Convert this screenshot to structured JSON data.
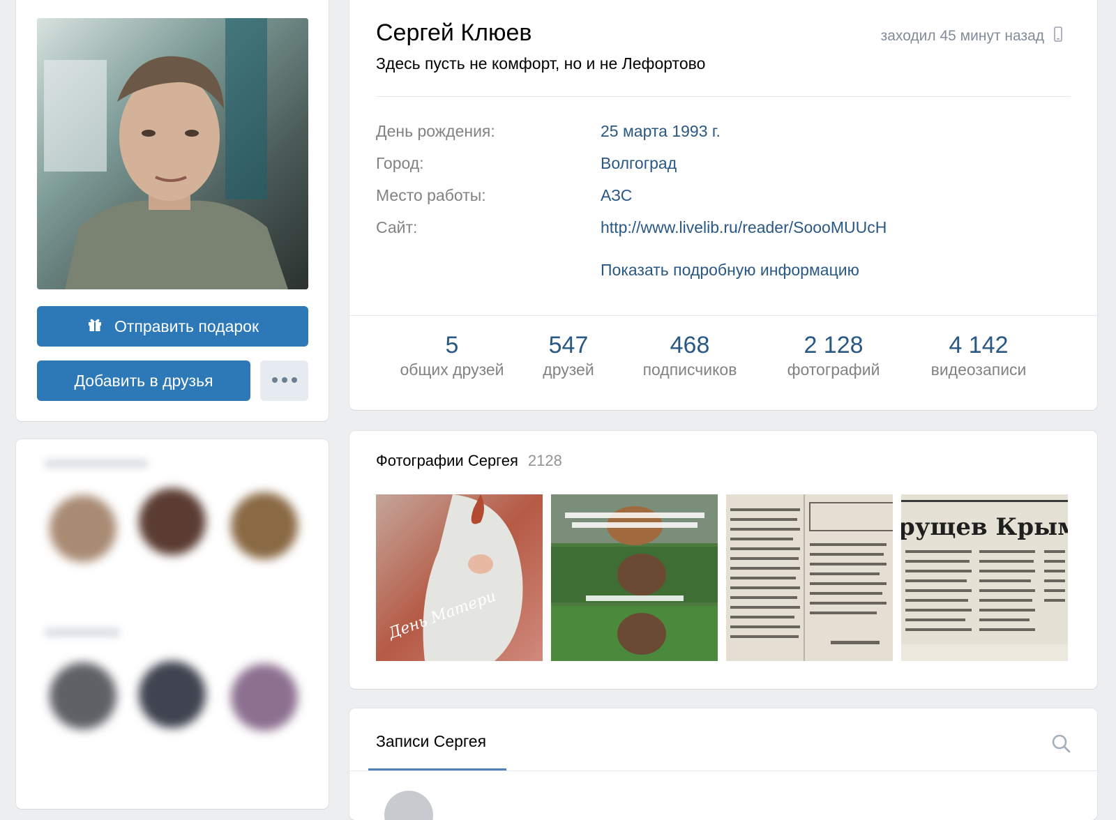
{
  "profile": {
    "name": "Сергей Клюев",
    "status": "Здесь пусть не комфорт, но и не Лефортово",
    "last_seen": "заходил 45 минут назад",
    "info": [
      {
        "label": "День рождения:",
        "value": "25 марта 1993 г."
      },
      {
        "label": "Город:",
        "value": "Волгоград"
      },
      {
        "label": "Место работы:",
        "value": "АЗС"
      },
      {
        "label": "Сайт:",
        "value": "http://www.livelib.ru/reader/SoooMUUcH"
      }
    ],
    "show_more": "Показать подробную информацию",
    "counters": [
      {
        "num": "5",
        "label": "общих друзей"
      },
      {
        "num": "547",
        "label": "друзей"
      },
      {
        "num": "468",
        "label": "подписчиков"
      },
      {
        "num": "2 128",
        "label": "фотографий"
      },
      {
        "num": "4 142",
        "label": "видеозаписи"
      }
    ]
  },
  "actions": {
    "gift_label": "Отправить подарок",
    "add_friend_label": "Добавить в друзья"
  },
  "photos": {
    "title": "Фотографии Сергея",
    "count": "2128",
    "items": [
      {
        "icon": "photo-mothers-day",
        "caption": "День Матери"
      },
      {
        "icon": "photo-movie-stills"
      },
      {
        "icon": "photo-newspaper-clipping"
      },
      {
        "icon": "photo-newspaper-headline",
        "caption": "рущев Крым"
      }
    ]
  },
  "posts": {
    "tab_label": "Записи Сергея"
  },
  "icons": {
    "gift": "gift-icon",
    "more": "more-icon",
    "phone": "phone-icon",
    "search": "search-icon"
  },
  "colors": {
    "accent": "#2d78b6",
    "link": "#2a5885",
    "muted": "#828282",
    "background": "#edeef0"
  }
}
